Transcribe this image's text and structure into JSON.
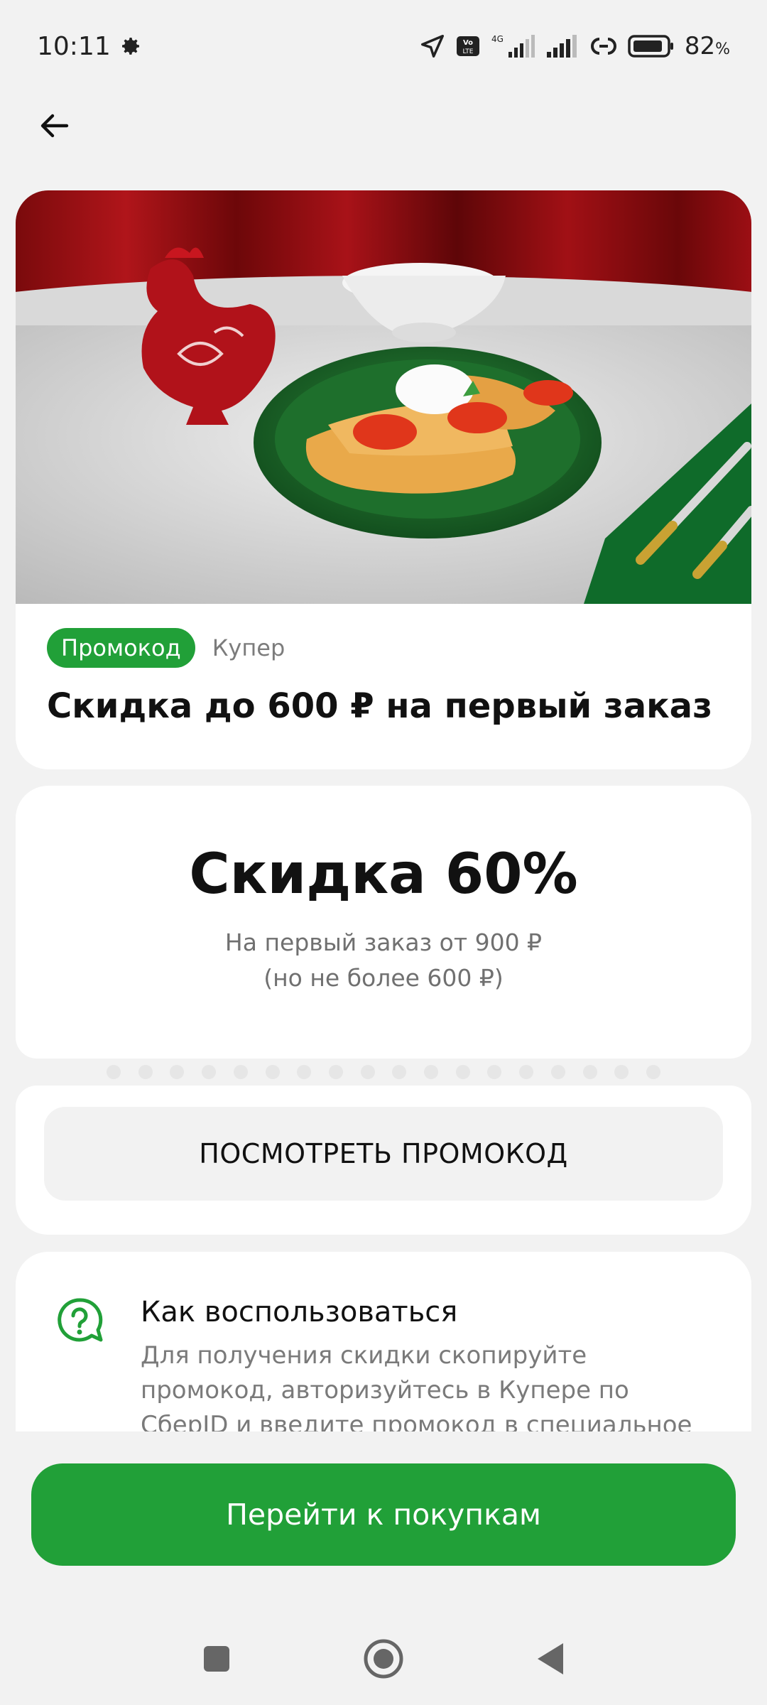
{
  "status_bar": {
    "time": "10:11",
    "network": "4G",
    "volte": "Vo LTE",
    "battery": "82",
    "battery_unit": "%"
  },
  "icons": {
    "back": "arrow-left-icon",
    "settings": "gear-icon",
    "location": "navigation-icon",
    "signal": "signal-icon",
    "battery": "battery-icon",
    "help": "question-chat-icon",
    "recent": "square-icon",
    "home": "circle-icon",
    "back_nav": "triangle-back-icon"
  },
  "offer": {
    "badge": "Промокод",
    "merchant": "Купер",
    "title": "Скидка до 600 ₽ на первый заказ"
  },
  "discount": {
    "headline": "Скидка 60%",
    "line1": "На первый заказ от 900 ₽",
    "line2": "(но не более 600 ₽)"
  },
  "promo": {
    "show_button": "ПОСМОТРЕТЬ ПРОМОКОД"
  },
  "howto": {
    "title": "Как воспользоваться",
    "text": "Для получения скидки скопируйте промокод, авторизуйтесь в Купере по СберID и введите промокод в специальное поле"
  },
  "cta": {
    "label": "Перейти к покупкам"
  },
  "colors": {
    "brand_green": "#21a038",
    "background": "#f2f2f2",
    "card": "#ffffff"
  }
}
